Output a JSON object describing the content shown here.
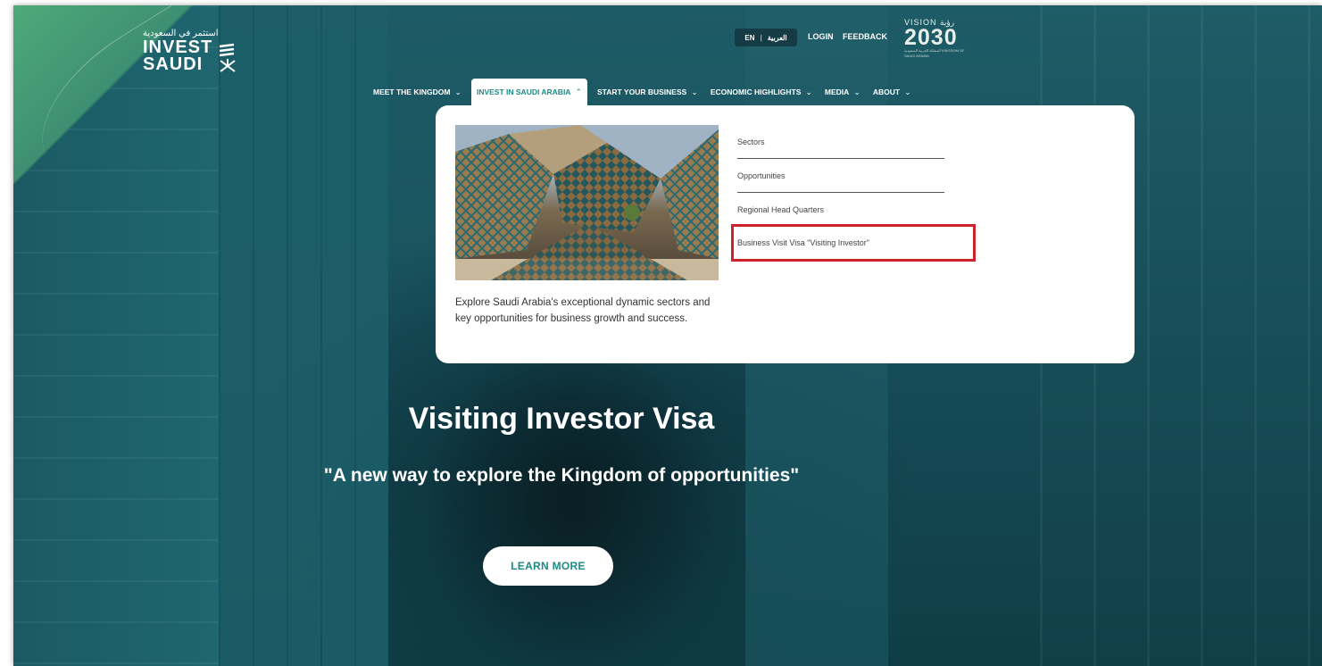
{
  "logo": {
    "arabic": "استثمر في السعودية",
    "line1": "INVEST",
    "line2": "SAUDI",
    "mark_icon": "invest-saudi-mark-icon"
  },
  "utility": {
    "lang_en": "EN",
    "lang_ar": "العربية",
    "login": "LOGIN",
    "feedback": "FEEDBACK"
  },
  "vision": {
    "top": "VISION رؤية",
    "number": "2030",
    "sub": "المملكة العربية السعودية KINGDOM OF SAUDI ARABIA"
  },
  "nav": {
    "items": [
      {
        "label": "MEET THE KINGDOM",
        "chevron": "chevron-down-icon"
      },
      {
        "label": "INVEST IN SAUDI ARABIA",
        "chevron": "chevron-up-icon"
      },
      {
        "label": "START YOUR BUSINESS",
        "chevron": "chevron-down-icon"
      },
      {
        "label": "ECONOMIC HIGHLIGHTS",
        "chevron": "chevron-down-icon"
      },
      {
        "label": "MEDIA",
        "chevron": "chevron-down-icon"
      },
      {
        "label": "ABOUT",
        "chevron": "chevron-down-icon"
      }
    ]
  },
  "dropdown": {
    "description": "Explore Saudi Arabia's exceptional dynamic sectors and key opportunities for business growth and success.",
    "links": [
      {
        "label": "Sectors"
      },
      {
        "label": "Opportunities"
      },
      {
        "label": "Regional Head Quarters"
      },
      {
        "label": "Business Visit Visa \"Visiting Investor\""
      }
    ]
  },
  "hero": {
    "title": "Visiting Investor Visa",
    "subtitle": "\"A new way to explore the Kingdom of opportunities\"",
    "button": "LEARN MORE"
  },
  "colors": {
    "accent": "#1d8a83",
    "highlight": "#d0202a",
    "background": "#1a5560"
  }
}
